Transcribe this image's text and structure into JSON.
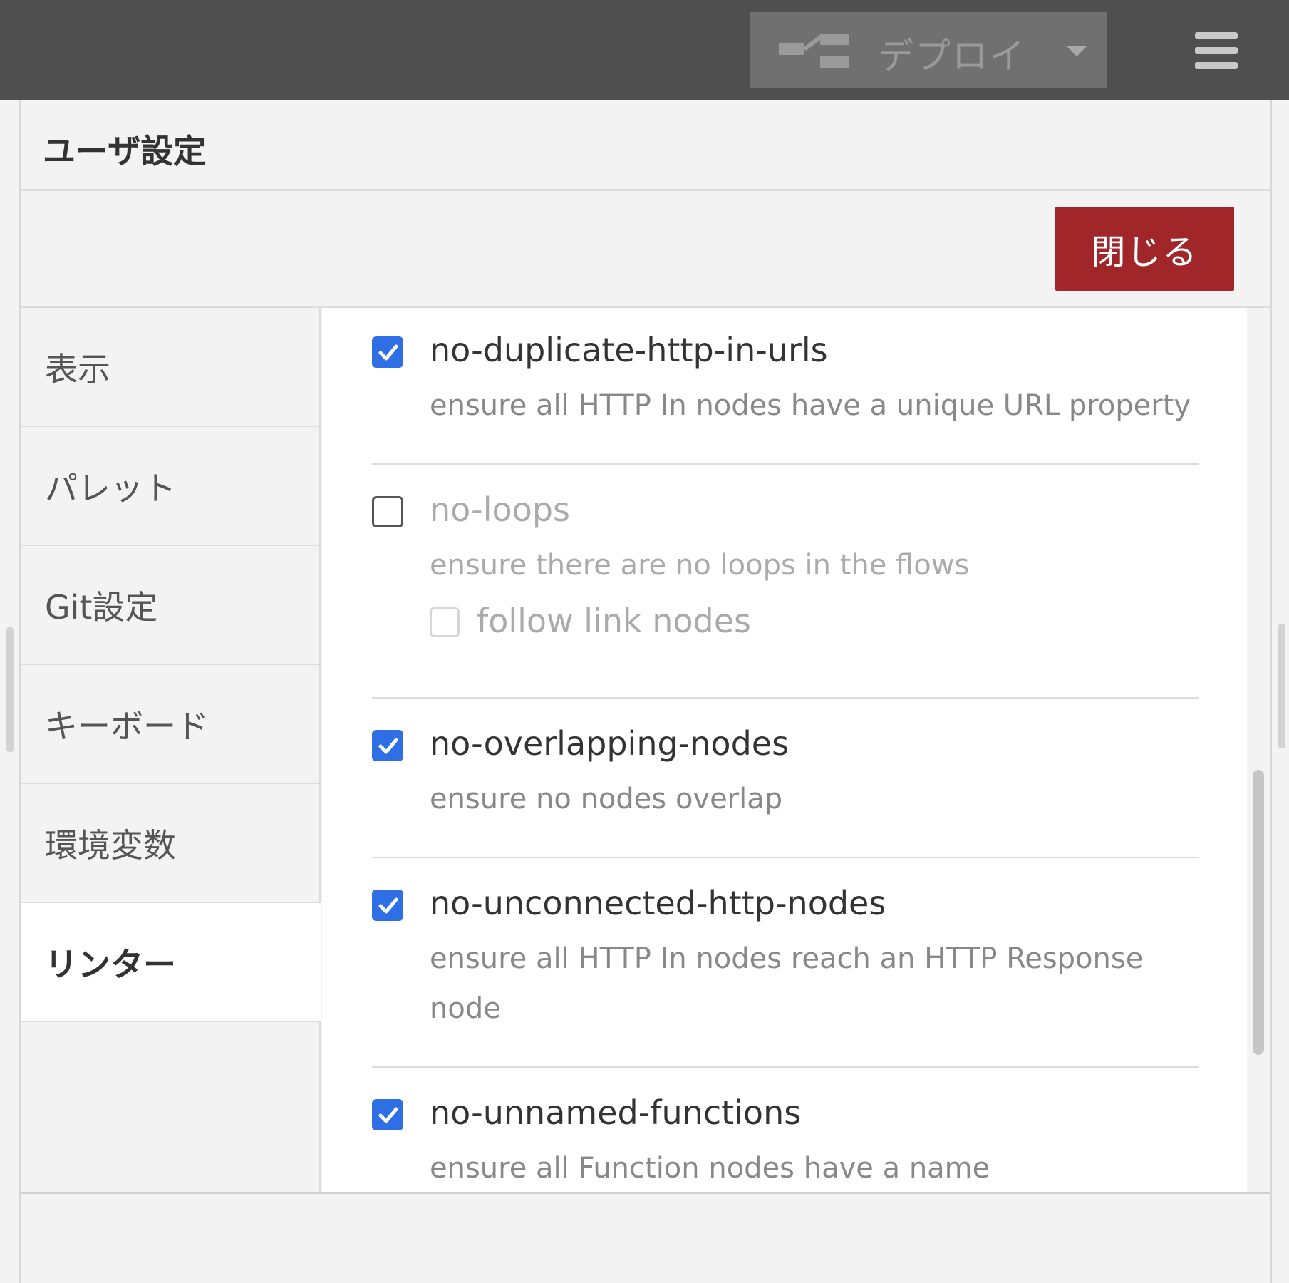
{
  "header": {
    "deploy_label": "デプロイ",
    "deploy_icon": "deploy-flow-icon",
    "caret_icon": "caret-down-icon",
    "menu_icon": "hamburger-menu-icon"
  },
  "dialog": {
    "title": "ユーザ設定",
    "close_label": "閉じる",
    "close_color": "#a0262a"
  },
  "tabs": [
    {
      "label": "表示",
      "active": false
    },
    {
      "label": "パレット",
      "active": false
    },
    {
      "label": "Git設定",
      "active": false
    },
    {
      "label": "キーボード",
      "active": false
    },
    {
      "label": "環境変数",
      "active": false
    },
    {
      "label": "リンター",
      "active": true
    }
  ],
  "rules": [
    {
      "name": "no-duplicate-http-in-urls",
      "description": "ensure all HTTP In nodes have a unique URL property",
      "checked": true
    },
    {
      "name": "no-loops",
      "description": "ensure there are no loops in the flows",
      "checked": false,
      "option": {
        "label": "follow link nodes",
        "checked": false
      }
    },
    {
      "name": "no-overlapping-nodes",
      "description": "ensure no nodes overlap",
      "checked": true
    },
    {
      "name": "no-unconnected-http-nodes",
      "description": "ensure all HTTP In nodes reach an HTTP Response node",
      "checked": true
    },
    {
      "name": "no-unnamed-functions",
      "description": "ensure all Function nodes have a name",
      "checked": true
    }
  ],
  "checkbox_color": "#2f6fe6"
}
